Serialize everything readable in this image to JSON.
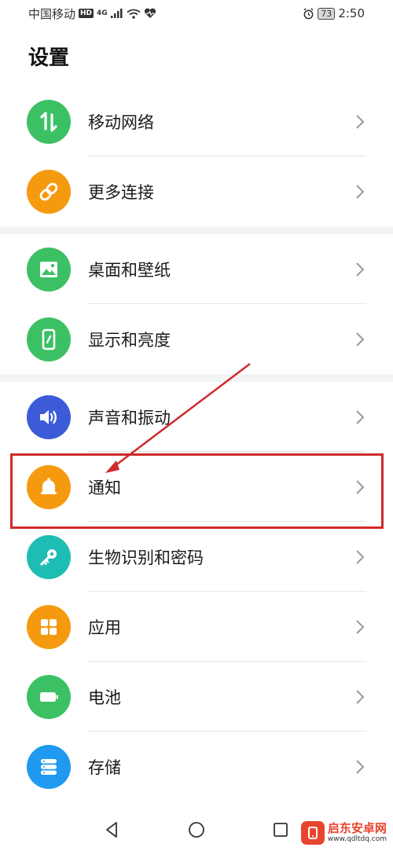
{
  "status_bar": {
    "carrier": "中国移动",
    "hd": "HD",
    "network": "4G",
    "battery": "73",
    "time": "2:50"
  },
  "page": {
    "title": "设置"
  },
  "groups": [
    {
      "items": [
        {
          "id": "mobile-network",
          "label": "移动网络",
          "color": "#3cc064",
          "icon": "mobile-data-icon"
        },
        {
          "id": "more-connections",
          "label": "更多连接",
          "color": "#f59a0f",
          "icon": "link-icon"
        }
      ]
    },
    {
      "items": [
        {
          "id": "home-wallpaper",
          "label": "桌面和壁纸",
          "color": "#3cc064",
          "icon": "image-icon"
        },
        {
          "id": "display-brightness",
          "label": "显示和亮度",
          "color": "#3cc064",
          "icon": "phone-display-icon"
        }
      ]
    },
    {
      "items": [
        {
          "id": "sound-vibration",
          "label": "声音和振动",
          "color": "#3d5bd9",
          "icon": "speaker-icon"
        },
        {
          "id": "notifications",
          "label": "通知",
          "color": "#f59a0f",
          "icon": "bell-icon"
        },
        {
          "id": "biometrics-password",
          "label": "生物识别和密码",
          "color": "#1ebdb4",
          "icon": "key-icon"
        },
        {
          "id": "apps",
          "label": "应用",
          "color": "#f59a0f",
          "icon": "grid-icon"
        },
        {
          "id": "battery",
          "label": "电池",
          "color": "#3cc064",
          "icon": "battery-icon"
        },
        {
          "id": "storage",
          "label": "存储",
          "color": "#1f9af0",
          "icon": "storage-icon"
        }
      ]
    }
  ],
  "annotation": {
    "highlight_color": "#d02a2a"
  },
  "watermark": {
    "name": "启东安卓网",
    "url": "www.qdltdq.com"
  }
}
